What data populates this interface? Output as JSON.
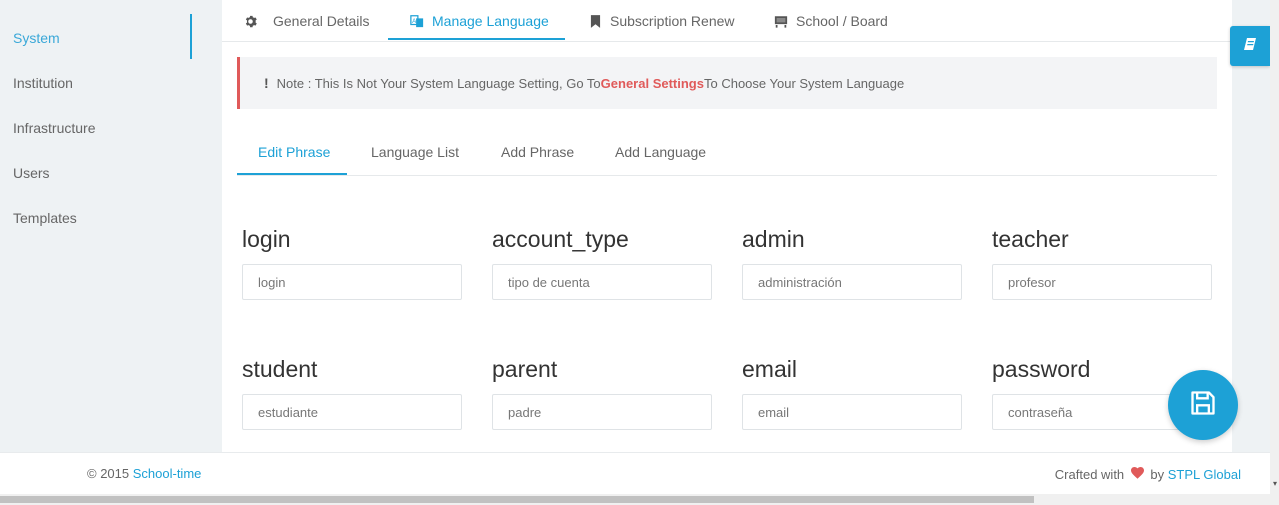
{
  "sidebar": {
    "items": [
      {
        "label": "System",
        "active": true
      },
      {
        "label": "Institution"
      },
      {
        "label": "Infrastructure"
      },
      {
        "label": "Users"
      },
      {
        "label": "Templates"
      }
    ]
  },
  "top_tabs": [
    {
      "label": "General Details",
      "icon": "gear-icon"
    },
    {
      "label": "Manage Language",
      "icon": "translate-icon",
      "active": true
    },
    {
      "label": "Subscription Renew",
      "icon": "bookmark-icon"
    },
    {
      "label": "School / Board",
      "icon": "presentation-board-icon"
    }
  ],
  "note": {
    "bang": "!",
    "prefix": "Note : This Is Not Your System Language Setting, Go To ",
    "link": "General Settings",
    "suffix": "To Choose Your System Language"
  },
  "sub_tabs": [
    {
      "label": "Edit Phrase",
      "active": true
    },
    {
      "label": "Language List"
    },
    {
      "label": "Add Phrase"
    },
    {
      "label": "Add Language"
    }
  ],
  "phrases": [
    {
      "key": "login",
      "value": "login"
    },
    {
      "key": "account_type",
      "value": "tipo de cuenta"
    },
    {
      "key": "admin",
      "value": "administración"
    },
    {
      "key": "teacher",
      "value": "profesor"
    },
    {
      "key": "student",
      "value": "estudiante"
    },
    {
      "key": "parent",
      "value": "padre"
    },
    {
      "key": "email",
      "value": "email"
    },
    {
      "key": "password",
      "value": "contraseña"
    }
  ],
  "footer": {
    "copyright": "© 2015 ",
    "brand": "School-time",
    "crafted": "Crafted with",
    "by": " by ",
    "company": "STPL Global"
  },
  "colors": {
    "accent": "#1da1d6",
    "danger": "#e05a5a"
  }
}
